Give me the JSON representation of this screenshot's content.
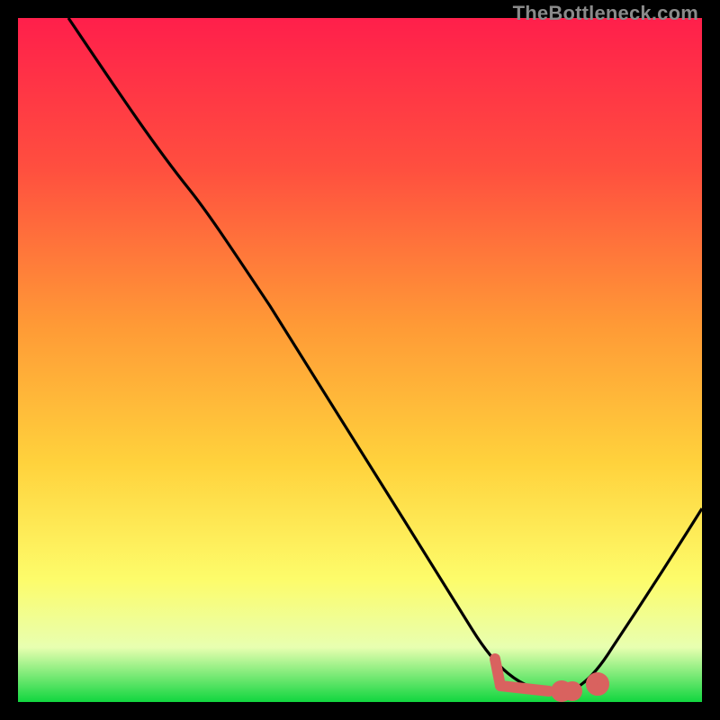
{
  "watermark": "TheBottleneck.com",
  "colors": {
    "bg": "#000000",
    "gradient_top": "#ff1f4b",
    "gradient_mid1": "#ff6a3a",
    "gradient_mid2": "#ffd23c",
    "gradient_low1": "#fdfc6a",
    "gradient_low2": "#e8ffb0",
    "gradient_bottom": "#11d63f",
    "curve": "#000000",
    "marker": "#d9625f"
  },
  "chart_data": {
    "type": "line",
    "title": "",
    "xlabel": "",
    "ylabel": "",
    "xlim": [
      0,
      100
    ],
    "ylim": [
      0,
      100
    ],
    "series": [
      {
        "name": "bottleneck-curve",
        "x": [
          0,
          5,
          10,
          15,
          20,
          25,
          30,
          35,
          40,
          45,
          50,
          55,
          60,
          65,
          70,
          75,
          80,
          85,
          90,
          95,
          100
        ],
        "values": [
          100,
          97,
          93,
          89,
          85,
          80,
          73,
          65,
          57,
          49,
          41,
          33,
          25,
          17,
          10,
          4,
          0,
          3,
          10,
          18,
          26
        ]
      }
    ],
    "annotations": [
      {
        "name": "marker-cluster",
        "x_range": [
          70,
          82
        ],
        "y": 2
      }
    ]
  }
}
